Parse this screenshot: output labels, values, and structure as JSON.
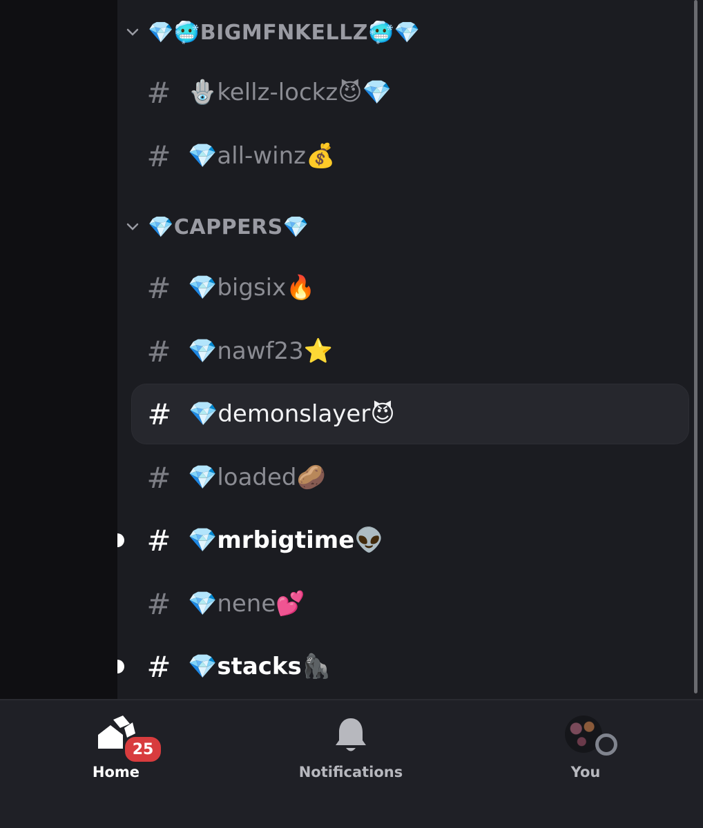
{
  "categories": [
    {
      "label": "💎🥶BIGMFNKELLZ🥶💎"
    },
    {
      "label": "💎CAPPERS💎"
    }
  ],
  "channels": [
    {
      "hash": "#",
      "name": "🪬kellz-lockz😈💎"
    },
    {
      "hash": "#",
      "name": "💎all-winz💰"
    },
    {
      "hash": "#",
      "name": "💎bigsix🔥"
    },
    {
      "hash": "#",
      "name": "💎nawf23⭐"
    },
    {
      "hash": "#",
      "name": "💎demonslayer😈"
    },
    {
      "hash": "#",
      "name": "💎loaded🥔"
    },
    {
      "hash": "#",
      "name": "💎mrbigtime👽"
    },
    {
      "hash": "#",
      "name": "💎nene💕"
    },
    {
      "hash": "#",
      "name": "💎stacks🦍"
    }
  ],
  "tabs": {
    "home": {
      "label": "Home",
      "badge": "25"
    },
    "notifications": {
      "label": "Notifications"
    },
    "you": {
      "label": "You"
    }
  },
  "colors": {
    "background": "#1b1c21",
    "rail": "#0f0f12",
    "active_row": "#26272d",
    "badge": "#d83c3e"
  }
}
